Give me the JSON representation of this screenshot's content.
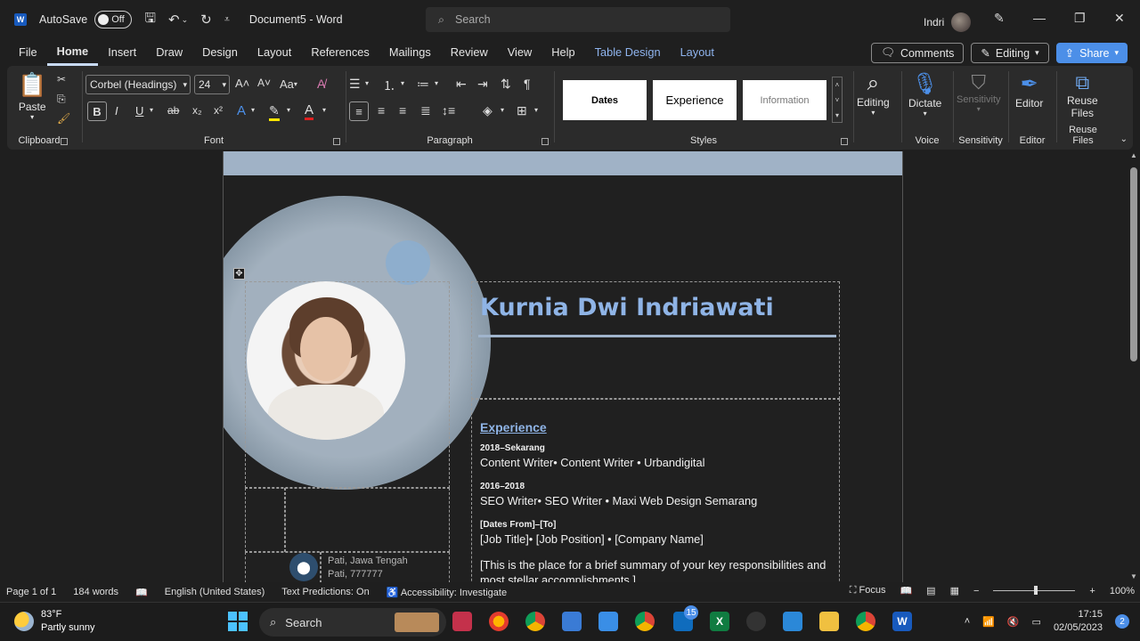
{
  "titlebar": {
    "autosave_label": "AutoSave",
    "autosave_state": "Off",
    "document_title": "Document5 - Word",
    "search_placeholder": "Search",
    "user_name": "Indri"
  },
  "menu": {
    "items": [
      "File",
      "Home",
      "Insert",
      "Draw",
      "Design",
      "Layout",
      "References",
      "Mailings",
      "Review",
      "View",
      "Help"
    ],
    "context_items": [
      "Table Design",
      "Layout"
    ],
    "active": "Home",
    "comments_label": "Comments",
    "editing_label": "Editing",
    "share_label": "Share"
  },
  "ribbon": {
    "clipboard": {
      "paste_label": "Paste",
      "group_label": "Clipboard"
    },
    "font": {
      "font_name": "Corbel (Headings)",
      "font_size": "24",
      "group_label": "Font",
      "case_label": "Aa"
    },
    "paragraph": {
      "group_label": "Paragraph"
    },
    "styles": {
      "tiles": [
        "Dates",
        "Experience",
        "Information"
      ],
      "group_label": "Styles"
    },
    "editing": {
      "label": "Editing"
    },
    "voice": {
      "dictate_label": "Dictate",
      "group_label": "Voice"
    },
    "sensitivity": {
      "label": "Sensitivity",
      "group_label": "Sensitivity"
    },
    "editor": {
      "label": "Editor",
      "group_label": "Editor"
    },
    "reuse": {
      "label_line1": "Reuse",
      "label_line2": "Files",
      "group_label": "Reuse Files"
    }
  },
  "document": {
    "name": "Kurnia Dwi Indriawati",
    "experience_heading": "Experience",
    "entries": [
      {
        "dates": "2018–Sekarang",
        "line": "Content Writer• Content Writer • Urbandigital"
      },
      {
        "dates": "2016–2018",
        "line": "SEO Writer• SEO Writer • Maxi Web Design Semarang"
      },
      {
        "dates": "[Dates From]–[To]",
        "line": "[Job Title]• [Job Position] • [Company Name]"
      }
    ],
    "summary_line1": "[This is the place for a brief summary of your key responsibilities and",
    "summary_line2": "most stellar accomplishments.]",
    "location_line1": "Pati, Jawa Tengah",
    "location_line2": "Pati, 777777"
  },
  "status": {
    "page": "Page 1 of 1",
    "words": "184 words",
    "language": "English (United States)",
    "predictions": "Text Predictions: On",
    "accessibility": "Accessibility: Investigate",
    "focus": "Focus",
    "zoom": "100%"
  },
  "taskbar": {
    "temperature": "83°F",
    "weather": "Partly sunny",
    "search_label": "Search",
    "outlook_badge": "15",
    "time": "17:15",
    "date": "02/05/2023",
    "notification_count": "2"
  },
  "colors": {
    "accent_blue": "#4c8fe8",
    "name_blue": "#8fb4e6",
    "header_band": "#a0b2c6",
    "word_blue": "#185abd"
  }
}
